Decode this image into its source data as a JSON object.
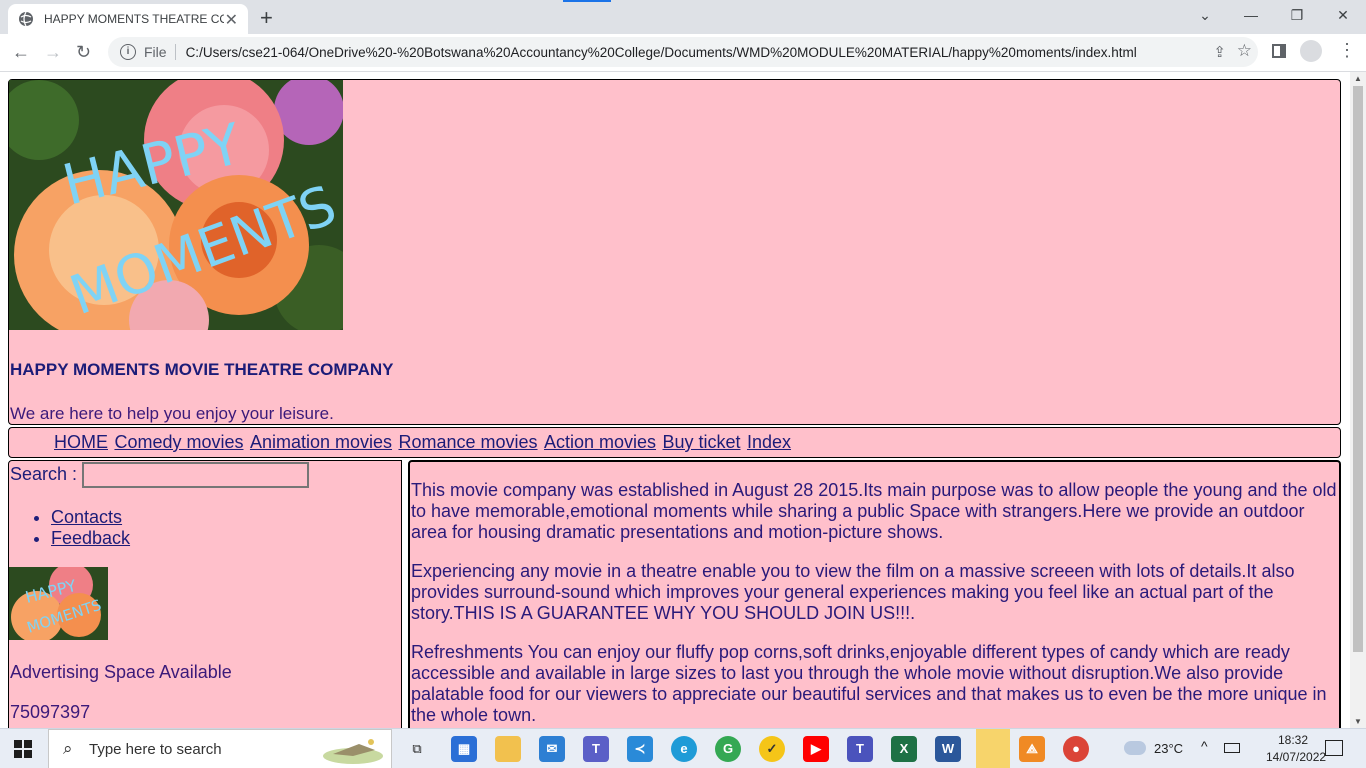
{
  "browser": {
    "tab_title": "HAPPY MOMENTS THEATRE COMPANY",
    "file_label": "File",
    "url": "C:/Users/cse21-064/OneDrive%20-%20Botswana%20Accountancy%20College/Documents/WMD%20MODULE%20MATERIAL/happy%20moments/index.html"
  },
  "header": {
    "logo_text_line1": "HAPPY",
    "logo_text_line2": "MOMENTS",
    "company_name": "HAPPY MOMENTS MOVIE THEATRE COMPANY",
    "tagline": "We are here to help you enjoy your leisure."
  },
  "nav": {
    "items": [
      {
        "label": "HOME"
      },
      {
        "label": "Comedy movies"
      },
      {
        "label": "Animation movies"
      },
      {
        "label": "Romance movies"
      },
      {
        "label": "Action movies"
      },
      {
        "label": "Buy ticket"
      },
      {
        "label": "Index"
      }
    ]
  },
  "sidebar": {
    "search_label": "Search :",
    "links": [
      {
        "label": "Contacts"
      },
      {
        "label": "Feedback"
      }
    ],
    "ad_text": "Advertising Space Available",
    "phone": "75097397"
  },
  "content": {
    "paragraphs": [
      "This movie company was established in August 28 2015.Its main purpose was to allow people the young and the old to have memorable,emotional moments while sharing a public Space with strangers.Here we provide an outdoor area for housing dramatic presentations and motion-picture shows.",
      "Experiencing any movie in a theatre enable you to view the film on a massive screeen with lots of details.It also provides surround-sound which improves your general experiences making you feel like an actual part of the story.THIS IS A GUARANTEE WHY YOU SHOULD JOIN US!!!.",
      "Refreshments You can enjoy our fluffy pop corns,soft drinks,enjoyable different types of candy which are ready accessible and available in large sizes to last you through the whole movie without disruption.We also provide palatable food for our viewers to appreciate our beautiful services and that makes us to even be the more unique in the whole town."
    ]
  },
  "taskbar": {
    "search_placeholder": "Type here to search",
    "temperature": "23°C",
    "time": "18:32",
    "date": "14/07/2022",
    "apps": [
      "task-view",
      "microsoft-store",
      "file-explorer",
      "mail",
      "teams",
      "vscode",
      "edge",
      "chrome-profile",
      "norton",
      "youtube",
      "teams-work",
      "excel",
      "word",
      "sticky-notes",
      "git-app",
      "chrome"
    ]
  },
  "colors": {
    "page_bg": "#ffc0cb",
    "text": "#1c1c78",
    "logo_text": "#7fd3f5"
  }
}
